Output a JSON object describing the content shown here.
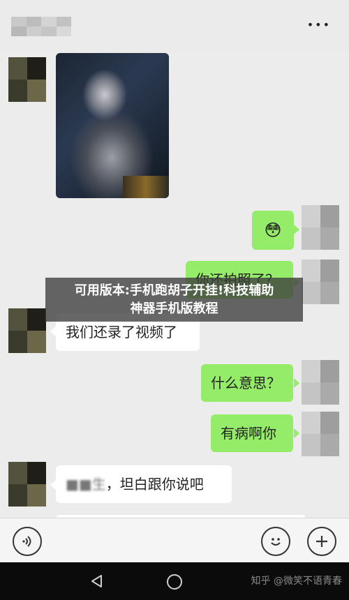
{
  "overlay": {
    "line1": "可用版本:手机跑胡子开挂!科技辅助",
    "line2": "神器手机版教程"
  },
  "header": {
    "menu_icon": "more-dots-icon",
    "menu_glyph": "•••"
  },
  "messages": [
    {
      "side": "left",
      "type": "image"
    },
    {
      "side": "right",
      "type": "emoji",
      "glyph": "😳"
    },
    {
      "side": "right",
      "type": "text",
      "text": "你还拍照了？"
    },
    {
      "side": "left",
      "type": "text",
      "text": "我们还录了视频了"
    },
    {
      "side": "right",
      "type": "text",
      "text": "什么意思？"
    },
    {
      "side": "right",
      "type": "text",
      "text": "有病啊你"
    },
    {
      "side": "left",
      "type": "text",
      "prefix": "■■生",
      "text": "，坦白跟你说吧"
    }
  ],
  "input_bar": {
    "voice_icon": "voice-icon",
    "emoji_icon": "emoji-face-icon",
    "add_icon": "plus-icon"
  },
  "nav": {
    "back_icon": "back-triangle-icon",
    "home_icon": "home-circle-icon"
  },
  "watermark": "知乎 @微笑不语青春",
  "colors": {
    "green_bubble": "#95ec69",
    "white_bubble": "#ffffff",
    "background": "#ececec"
  }
}
